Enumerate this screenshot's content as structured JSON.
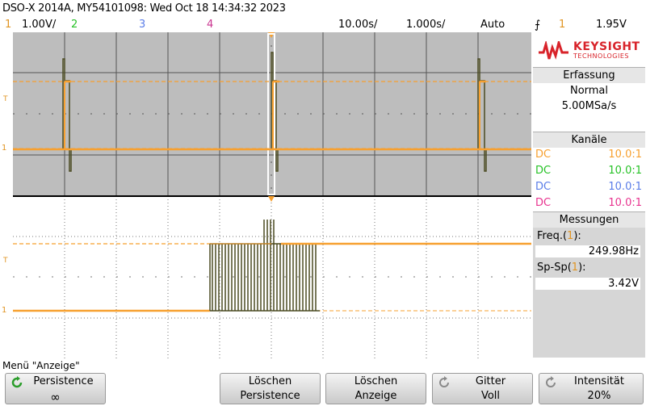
{
  "header": {
    "title": "DSO-X 2014A, MY54101098: Wed Oct 18 14:34:32 2023",
    "ch1_num": "1",
    "ch1_scale": "1.00V/",
    "ch2_num": "2",
    "ch3_num": "3",
    "ch4_num": "4",
    "timebase": "10.00s/",
    "zoom_timebase": "1.000s/",
    "trigger_mode": "Auto",
    "trigger_channel": "1",
    "trigger_level": "1.95V"
  },
  "brand": {
    "name": "KEYSIGHT",
    "sub": "TECHNOLOGIES"
  },
  "acquisition": {
    "heading": "Erfassung",
    "mode": "Normal",
    "rate": "5.00MSa/s"
  },
  "channels": {
    "heading": "Kanäle",
    "rows": [
      {
        "coupling": "DC",
        "ratio": "10.0:1",
        "color": "#f7a02f"
      },
      {
        "coupling": "DC",
        "ratio": "10.0:1",
        "color": "#27c227"
      },
      {
        "coupling": "DC",
        "ratio": "10.0:1",
        "color": "#5a7de8"
      },
      {
        "coupling": "DC",
        "ratio": "10.0:1",
        "color": "#e8338f"
      }
    ]
  },
  "measurements": {
    "heading": "Messungen",
    "freq_label": "Freq.(",
    "freq_ch": "1",
    "freq_close": "):",
    "freq_value": "249.98Hz",
    "vpp_label": "Sp-Sp(",
    "vpp_ch": "1",
    "vpp_close": "):",
    "vpp_value": "3.42V"
  },
  "menu": {
    "label": "Menü \"Anzeige\"",
    "keys": [
      {
        "line1": "Persistence",
        "line2": "∞"
      },
      {
        "line1": "Löschen",
        "line2": "Persistence"
      },
      {
        "line1": "Löschen",
        "line2": "Anzeige"
      },
      {
        "line1": "Gitter",
        "line2": "Voll"
      },
      {
        "line1": "Intensität",
        "line2": "20%"
      }
    ]
  },
  "colors": {
    "ch1": "#f7a02f",
    "ch2": "#27c227",
    "ch3": "#5a7de8",
    "ch4": "#e8338f",
    "trace_dim": "#4b4b22",
    "brand_red": "#d8232a"
  },
  "markers": {
    "trigger_mark": "T",
    "ground_mark": "1"
  }
}
